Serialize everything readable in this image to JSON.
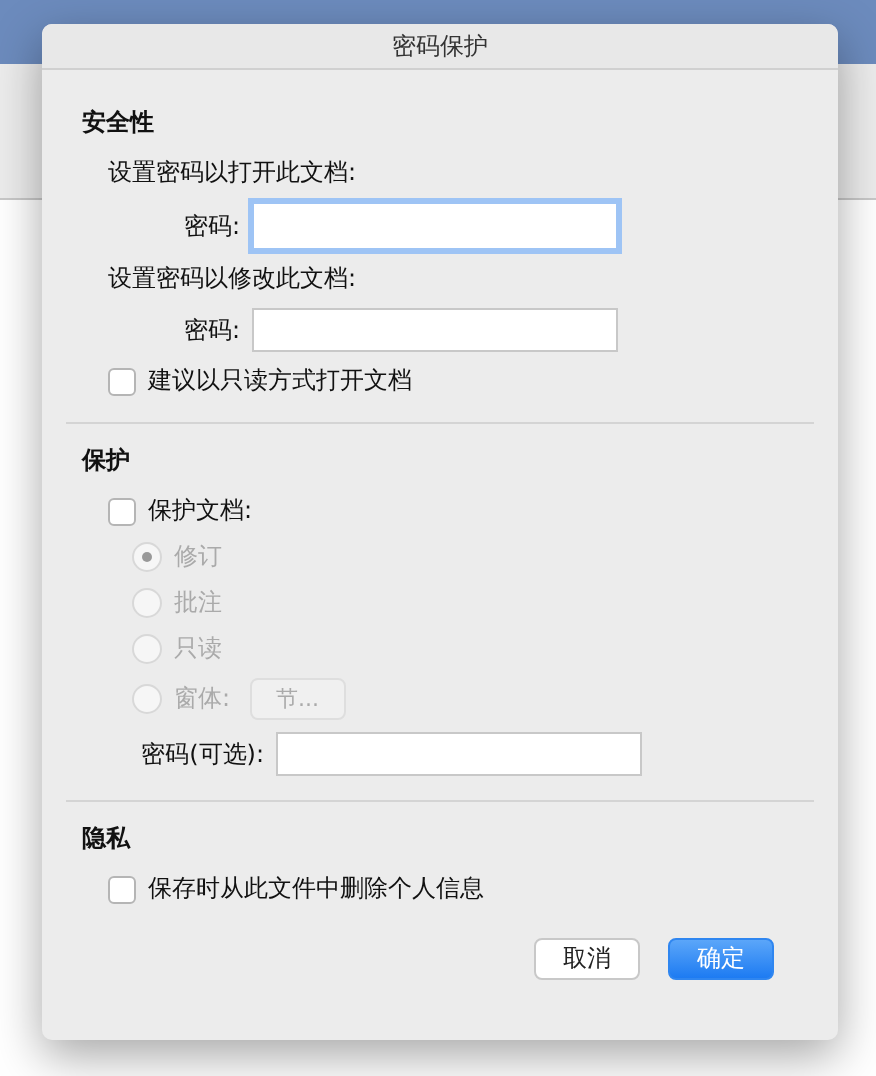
{
  "dialog": {
    "title": "密码保护"
  },
  "security": {
    "heading": "安全性",
    "open": {
      "caption": "设置密码以打开此文档:",
      "label": "密码:",
      "focused": true
    },
    "modify": {
      "caption": "设置密码以修改此文档:",
      "label": "密码:",
      "focused": false
    },
    "readonly": {
      "label": "建议以只读方式打开文档",
      "checked": false
    }
  },
  "protection": {
    "heading": "保护",
    "protect": {
      "label": "保护文档:",
      "checked": false
    },
    "options": [
      {
        "label": "修订",
        "selected": true,
        "disabled": true
      },
      {
        "label": "批注",
        "selected": false,
        "disabled": true
      },
      {
        "label": "只读",
        "selected": false,
        "disabled": true
      },
      {
        "label": "窗体:",
        "selected": false,
        "disabled": true,
        "button": "节..."
      }
    ],
    "password": {
      "label": "密码(可选):",
      "focused": false
    }
  },
  "privacy": {
    "heading": "隐私",
    "remove": {
      "label": "保存时从此文件中删除个人信息",
      "checked": false
    }
  },
  "buttons": [
    {
      "label": "取消",
      "kind": "secondary"
    },
    {
      "label": "确定",
      "kind": "primary"
    }
  ]
}
